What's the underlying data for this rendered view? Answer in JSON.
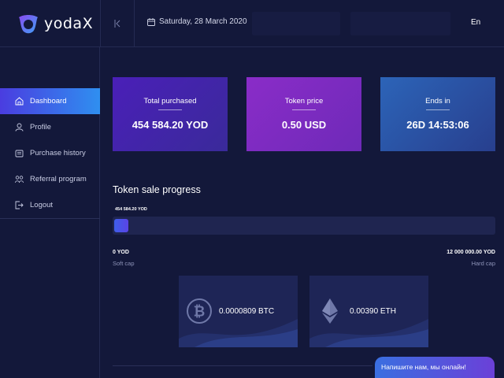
{
  "header": {
    "logo_text": "yodaX",
    "date": "Saturday, 28 March 2020",
    "language": "En"
  },
  "sidebar": {
    "items": [
      {
        "label": "Dashboard",
        "icon": "home-icon",
        "active": true
      },
      {
        "label": "Profile",
        "icon": "user-icon",
        "active": false
      },
      {
        "label": "Purchase history",
        "icon": "wallet-icon",
        "active": false
      },
      {
        "label": "Referral program",
        "icon": "referral-icon",
        "active": false
      },
      {
        "label": "Logout",
        "icon": "logout-icon",
        "active": false
      }
    ]
  },
  "cards": [
    {
      "title": "Total purchased",
      "value": "454 584.20 YOD"
    },
    {
      "title": "Token price",
      "value": "0.50 USD"
    },
    {
      "title": "Ends in",
      "value": "26D 14:53:06"
    }
  ],
  "progress": {
    "title": "Token sale progress",
    "current_label": "454 584.20 YOD",
    "fraction": 0.038,
    "soft_cap_value": "0 YOD",
    "soft_cap_label": "Soft cap",
    "hard_cap_value": "12 000 000.00 YOD",
    "hard_cap_label": "Hard cap"
  },
  "crypto": [
    {
      "icon": "bitcoin-icon",
      "amount": "0.0000809 BTC"
    },
    {
      "icon": "ethereum-icon",
      "amount": "0.00390 ETH"
    }
  ],
  "chat": {
    "text": "Напишите нам, мы онлайн!"
  },
  "colors": {
    "background": "#13183a",
    "accent": "#4a3de0",
    "card_purchased": "#4a1fb8",
    "card_price": "#8a2cc8",
    "card_ends": "#2c64b8"
  }
}
